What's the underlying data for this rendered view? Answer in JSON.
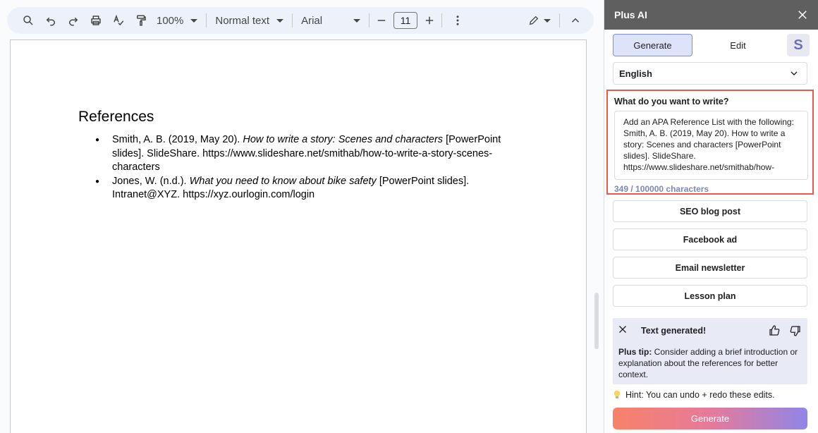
{
  "toolbar": {
    "zoom": "100%",
    "style": "Normal text",
    "font": "Arial",
    "font_size": "11"
  },
  "document": {
    "heading": "References",
    "references": [
      {
        "pre": "Smith, A. B. (2019, May 20). ",
        "title": "How to write a story: Scenes and characters",
        "post": " [PowerPoint slides]. SlideShare. https://www.slideshare.net/smithab/how-to-write-a-story-scenes-characters"
      },
      {
        "pre": "Jones, W. (n.d.). ",
        "title": "What you need to know about bike safety",
        "post": " [PowerPoint slides]. Intranet@XYZ. https://xyz.ourlogin.com/login"
      }
    ]
  },
  "panel": {
    "title": "Plus AI",
    "tab_generate": "Generate",
    "tab_edit": "Edit",
    "avatar_letter": "S",
    "language": "English",
    "prompt_label": "What do you want to write?",
    "prompt_text": "Add an APA Reference List with the following:\nSmith, A. B. (2019, May 20). How to write a story: Scenes and characters [PowerPoint slides]. SlideShare.\nhttps://www.slideshare.net/smithab/how-",
    "char_count": "349 / 100000 characters",
    "presets": [
      "SEO blog post",
      "Facebook ad",
      "Email newsletter",
      "Lesson plan"
    ],
    "result_title": "Text generated!",
    "tip_label": "Plus tip:",
    "tip_text": " Consider adding a brief introduction or explanation about the references for better context.",
    "hint": "Hint: You can undo + redo these edits.",
    "generate_button": "Generate"
  },
  "colors": {
    "toolbar_bg": "#edf2fa",
    "panel_header": "#5f5f5f",
    "active_tab": "#dde3fb",
    "highlight_border": "#ea5a47",
    "result_bg": "#e8eaf6",
    "char_count": "#7d87b8"
  }
}
